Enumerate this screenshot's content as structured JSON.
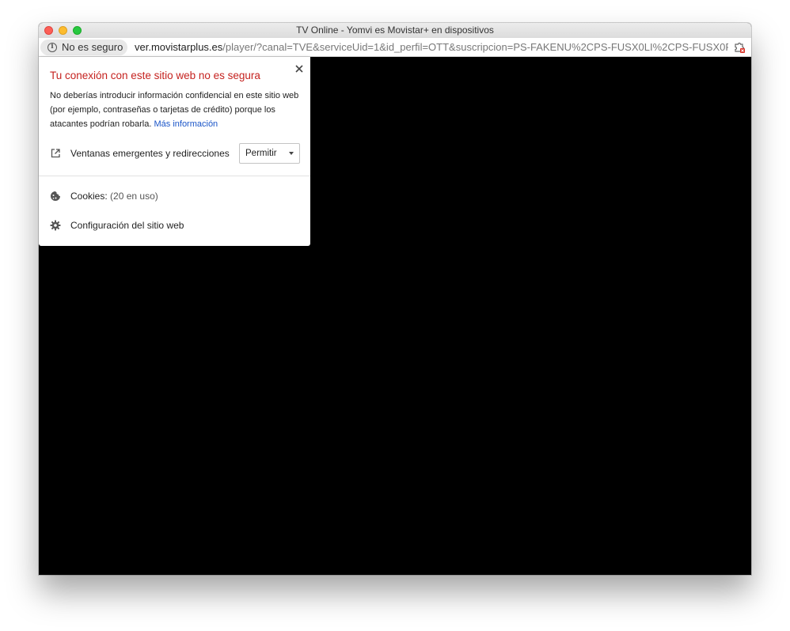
{
  "window": {
    "title": "TV Online - Yomvi es Movistar+ en dispositivos"
  },
  "addressbar": {
    "security_label": "No es seguro",
    "url_host": "ver.movistarplus.es",
    "url_rest": "/player/?canal=TVE&serviceUid=1&id_perfil=OTT&suscripcion=PS-FAKENU%2CPS-FUSX0LI%2CPS-FUSX0P..."
  },
  "popup": {
    "title": "Tu conexión con este sitio web no es segura",
    "description": "No deberías introducir información confidencial en este sitio web (por ejemplo, contraseñas o tarjetas de crédito) porque los atacantes podrían robarla.",
    "learn_more": "Más información",
    "popups_label": "Ventanas emergentes y redirecciones",
    "popups_value": "Permitir",
    "cookies_label": "Cookies:",
    "cookies_count": "(20 en uso)",
    "site_settings_label": "Configuración del sitio web"
  },
  "colors": {
    "warning_title": "#c5221f",
    "link": "#1a55c8",
    "page_background": "#000000"
  },
  "icons": [
    "info-icon",
    "extension-blocked-icon",
    "close-icon",
    "open-external-icon",
    "cookie-icon",
    "gear-icon",
    "caret-down-icon"
  ]
}
